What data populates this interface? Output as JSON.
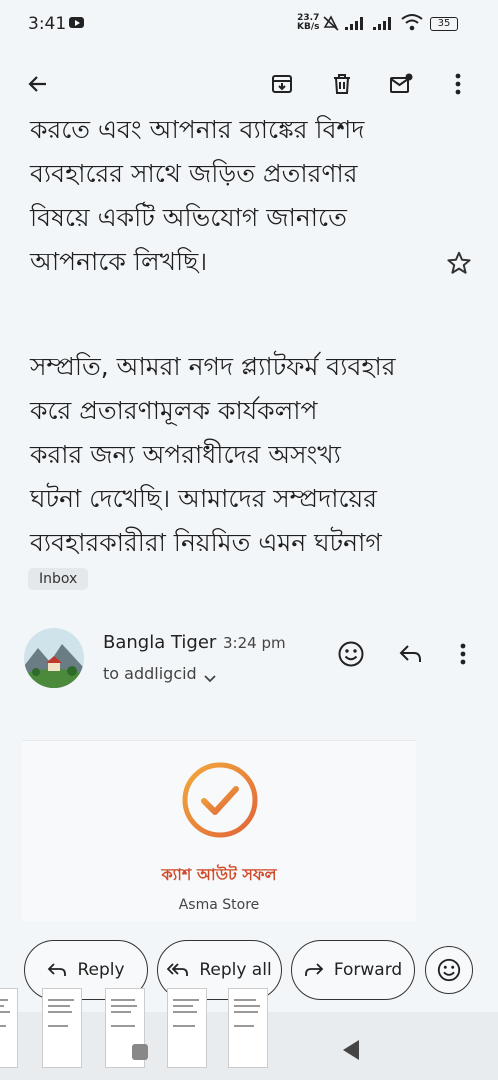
{
  "status": {
    "time": "3:41",
    "speed_value": "23.7",
    "speed_unit": "KB/s",
    "battery": "35"
  },
  "toolbar": {
    "back": "back-arrow-icon",
    "archive": "archive-icon",
    "delete": "delete-icon",
    "mark_unread": "mark-unread-icon",
    "more": "more-vert-icon"
  },
  "message": {
    "paragraph1_lines": [
      "করতে এবং আপনার ব্যাঙ্কের বিশদ",
      "ব্যবহারের সাথে জড়িত প্রতারণার",
      "বিষয়ে একটি অভিযোগ জানাতে",
      "আপনাকে লিখছি।"
    ],
    "paragraph2_lines": [
      "সম্প্রতি, আমরা নগদ প্ল্যাটফর্ম ব্যবহার",
      "করে প্রতারণামূলক কার্যকলাপ",
      "করার জন্য অপরাধীদের অসংখ্য",
      "ঘটনা দেখেছি। আমাদের সম্প্রদায়ের",
      "ব্যবহারকারীরা নিয়মিত এমন ঘটনাগ"
    ],
    "label": "Inbox"
  },
  "email2": {
    "sender": "Bangla Tiger",
    "time": "3:24 pm",
    "to": "to addligcid",
    "card": {
      "title": "ক্যাশ আউট সফল",
      "store": "Asma Store"
    }
  },
  "actions": {
    "reply": "Reply",
    "reply_all": "Reply all",
    "forward": "Forward"
  },
  "colors": {
    "accent_orange": "#e8923a",
    "cash_red": "#d14a2a"
  }
}
